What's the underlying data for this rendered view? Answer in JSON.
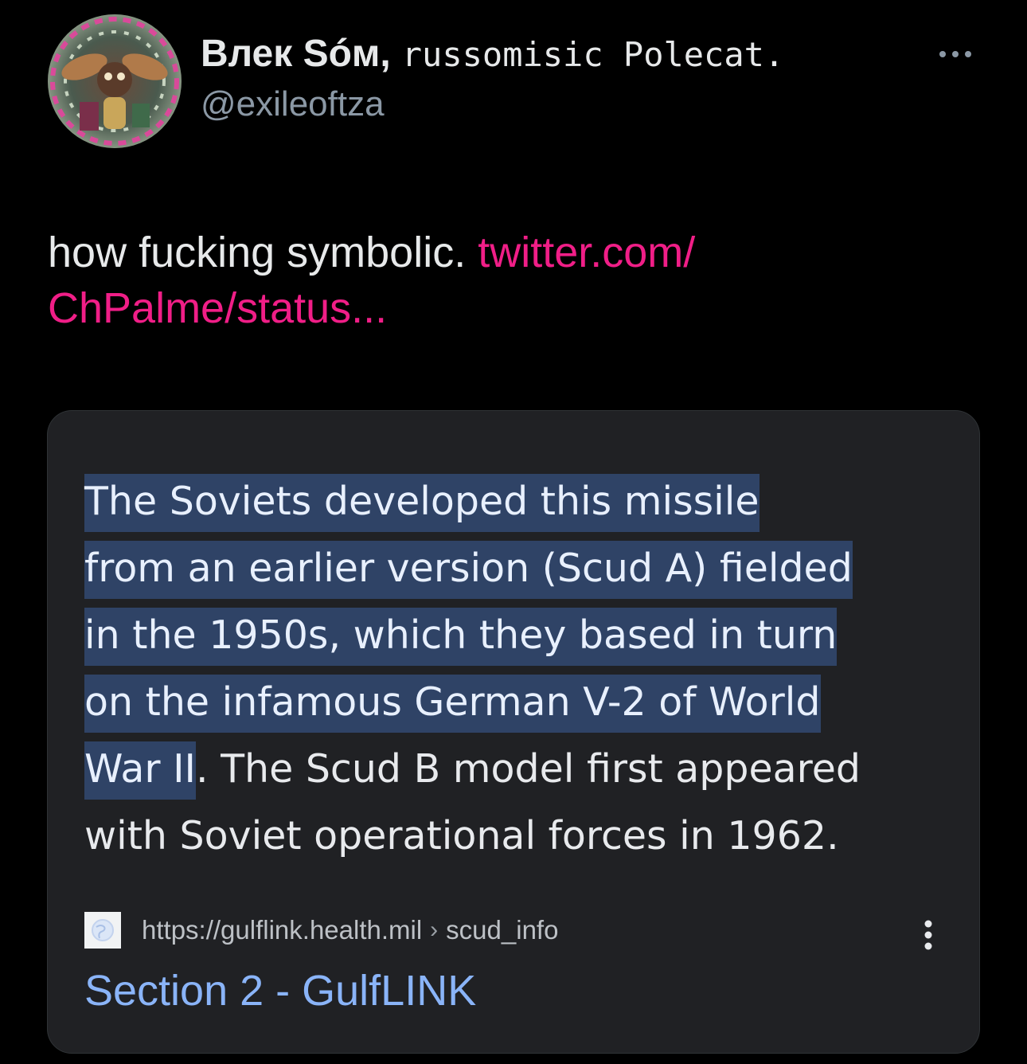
{
  "author": {
    "display_name": "Влек Sóм,",
    "display_name_suffix": "russomisic Polecat.",
    "handle": "@exileoftza"
  },
  "tweet": {
    "text": "how fucking symbolic. ",
    "link_line1": "twitter.com/",
    "link_line2": "ChPalme/status..."
  },
  "media": {
    "snippet_lines": [
      {
        "highlighted": "The Soviets developed this missile",
        "rest": ""
      },
      {
        "highlighted": "from an earlier version (Scud A) fielded",
        "rest": ""
      },
      {
        "highlighted": "in the 1950s, which they based in turn",
        "rest": ""
      },
      {
        "highlighted": "on the infamous German V-2 of World",
        "rest": ""
      },
      {
        "highlighted": "War II",
        "rest": ". The Scud B model first appeared"
      },
      {
        "highlighted": "",
        "rest": "with Soviet operational forces in 1962."
      }
    ],
    "source": {
      "url": "https://gulflink.health.mil",
      "separator": "›",
      "path": "scud_info"
    },
    "result_title": "Section 2 - GulfLINK"
  },
  "colors": {
    "background": "#000000",
    "link": "#f01e87",
    "handle": "#8b98a5",
    "card_bg": "#202124",
    "highlight": "#2f4366",
    "result_title": "#8ab4f8"
  },
  "icons": {
    "more": "more-horizontal-icon",
    "kebab": "more-vertical-icon",
    "favicon": "globe-icon"
  }
}
